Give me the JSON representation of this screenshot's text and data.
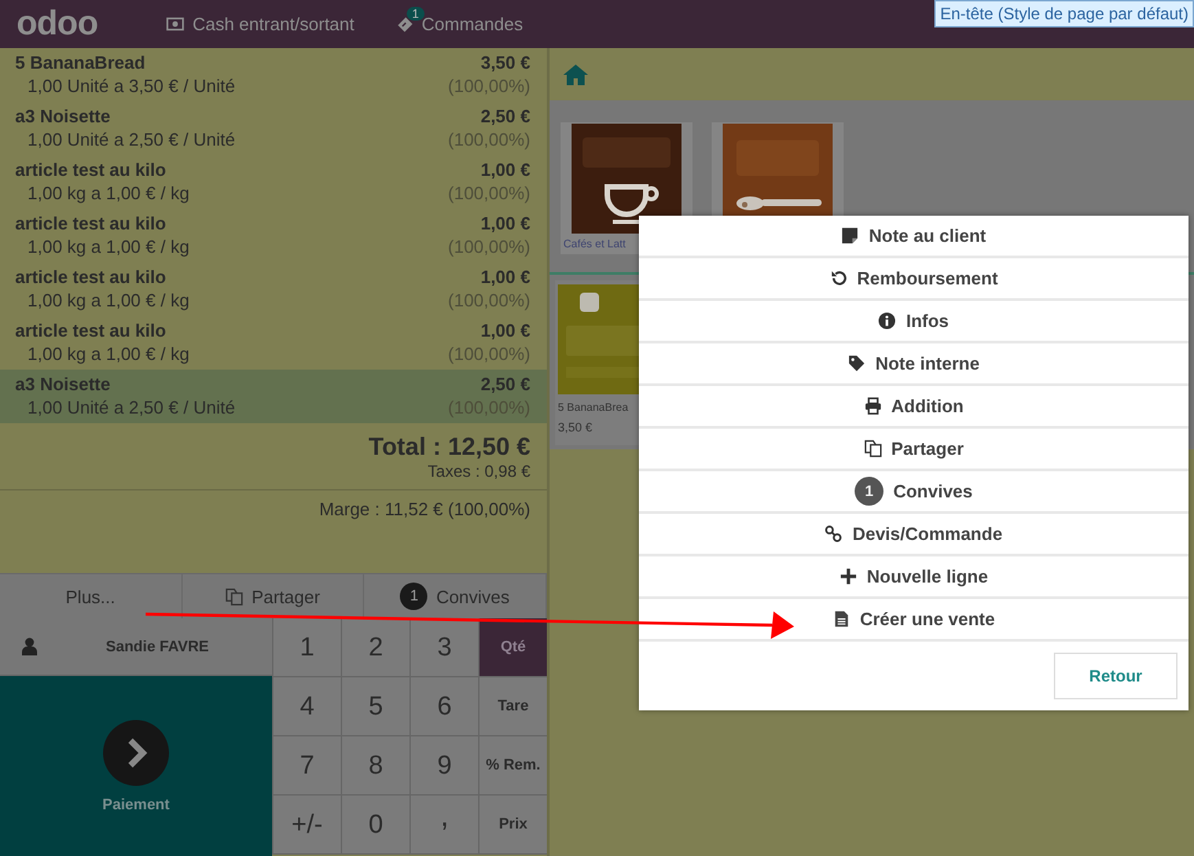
{
  "top_bar": {
    "logo": "odoo",
    "nav": [
      {
        "label": "Cash entrant/sortant",
        "kind": "cash"
      },
      {
        "label": "Commandes",
        "kind": "orders",
        "badge": "1"
      }
    ],
    "tooltip": "En-tête (Style de page par défaut)"
  },
  "order": {
    "lines": [
      {
        "product": "5 BananaBread",
        "price": "3,50 €",
        "detail": "1,00 Unité a 3,50 € / Unité",
        "margin": "(100,00%)",
        "selected": false
      },
      {
        "product": "a3 Noisette",
        "price": "2,50 €",
        "detail": "1,00 Unité a 2,50 € / Unité",
        "margin": "(100,00%)",
        "selected": false
      },
      {
        "product": "article test au kilo",
        "price": "1,00 €",
        "detail": "1,00 kg a 1,00 € / kg",
        "margin": "(100,00%)",
        "selected": false
      },
      {
        "product": "article test au kilo",
        "price": "1,00 €",
        "detail": "1,00 kg a 1,00 € / kg",
        "margin": "(100,00%)",
        "selected": false
      },
      {
        "product": "article test au kilo",
        "price": "1,00 €",
        "detail": "1,00 kg a 1,00 € / kg",
        "margin": "(100,00%)",
        "selected": false
      },
      {
        "product": "article test au kilo",
        "price": "1,00 €",
        "detail": "1,00 kg a 1,00 € / kg",
        "margin": "(100,00%)",
        "selected": false
      },
      {
        "product": "a3 Noisette",
        "price": "2,50 €",
        "detail": "1,00 Unité a 2,50 € / Unité",
        "margin": "(100,00%)",
        "selected": true
      }
    ],
    "total": "Total : 12,50 €",
    "taxes": "Taxes : 0,98 €",
    "margin": "Marge : 11,52 € (100,00%)"
  },
  "actions": [
    {
      "label": "Plus...",
      "kind": "plain"
    },
    {
      "label": "Partager",
      "kind": "split"
    },
    {
      "label": "Convives",
      "kind": "guests",
      "badge": "1"
    }
  ],
  "customer": "Sandie FAVRE",
  "payment": "Paiement",
  "numpad": [
    {
      "label": "1",
      "kind": "digit",
      "selected": false
    },
    {
      "label": "2",
      "kind": "digit",
      "selected": false
    },
    {
      "label": "3",
      "kind": "digit",
      "selected": false
    },
    {
      "label": "Qté",
      "kind": "mode",
      "selected": true
    },
    {
      "label": "4",
      "kind": "digit",
      "selected": false
    },
    {
      "label": "5",
      "kind": "digit",
      "selected": false
    },
    {
      "label": "6",
      "kind": "digit",
      "selected": false
    },
    {
      "label": "Tare",
      "kind": "mode",
      "selected": false
    },
    {
      "label": "7",
      "kind": "digit",
      "selected": false
    },
    {
      "label": "8",
      "kind": "digit",
      "selected": false
    },
    {
      "label": "9",
      "kind": "digit",
      "selected": false
    },
    {
      "label": "% Rem.",
      "kind": "mode",
      "selected": false
    },
    {
      "label": "+/-",
      "kind": "digit",
      "selected": false
    },
    {
      "label": "0",
      "kind": "digit",
      "selected": false
    },
    {
      "label": ",",
      "kind": "separator",
      "selected": false
    },
    {
      "label": "Prix",
      "kind": "mode",
      "selected": false
    }
  ],
  "categories": [
    {
      "label": "Cafés et Latt",
      "kind": "coffee"
    },
    {
      "kind": "spoon"
    }
  ],
  "products": [
    {
      "name": "5 BananaBrea",
      "price": "3,50 €",
      "kind": "banana"
    }
  ],
  "popup": {
    "items": [
      {
        "label": "Note au client",
        "kind": "note"
      },
      {
        "label": "Remboursement",
        "kind": "refund"
      },
      {
        "label": "Infos",
        "kind": "info"
      },
      {
        "label": "Note interne",
        "kind": "tag"
      },
      {
        "label": "Addition",
        "kind": "print"
      },
      {
        "label": "Partager",
        "kind": "split"
      },
      {
        "label": "Convives",
        "kind": "guests",
        "badge": "1"
      },
      {
        "label": "Devis/Commande",
        "kind": "link"
      },
      {
        "label": "Nouvelle ligne",
        "kind": "plus"
      },
      {
        "label": "Créer une vente",
        "kind": "file"
      }
    ],
    "button": "Retour"
  }
}
